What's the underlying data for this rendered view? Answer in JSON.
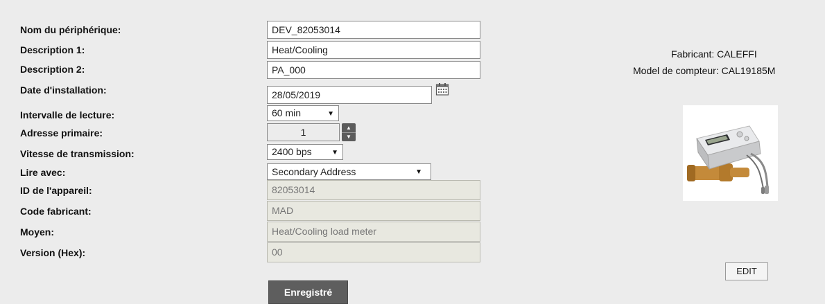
{
  "labels": {
    "device_name": "Nom du périphérique:",
    "description1": "Description 1:",
    "description2": "Description 2:",
    "install_date": "Date d'installation:",
    "read_interval": "Intervalle de lecture:",
    "primary_address": "Adresse primaire:",
    "baud_rate": "Vitesse de transmission:",
    "read_with": "Lire avec:",
    "device_id": "ID de l'appareil:",
    "manufacturer_code": "Code fabricant:",
    "medium": "Moyen:",
    "version_hex": "Version (Hex):"
  },
  "values": {
    "device_name": "DEV_82053014",
    "description1": "Heat/Cooling",
    "description2": "PA_000",
    "install_date": "28/05/2019",
    "read_interval": "60 min",
    "primary_address": "1",
    "baud_rate": "2400 bps",
    "read_with": "Secondary Address",
    "device_id": "82053014",
    "manufacturer_code": "MAD",
    "medium": "Heat/Cooling load meter",
    "version_hex": "00"
  },
  "buttons": {
    "save": "Enregistré",
    "edit": "EDIT"
  },
  "info": {
    "manufacturer": "Fabricant: CALEFFI",
    "meter_model": "Model de compteur: CAL19185M"
  },
  "icons": {
    "calendar": "calendar-icon",
    "spinner": "spinner-icon",
    "dropdown": "chevron-down-icon"
  }
}
